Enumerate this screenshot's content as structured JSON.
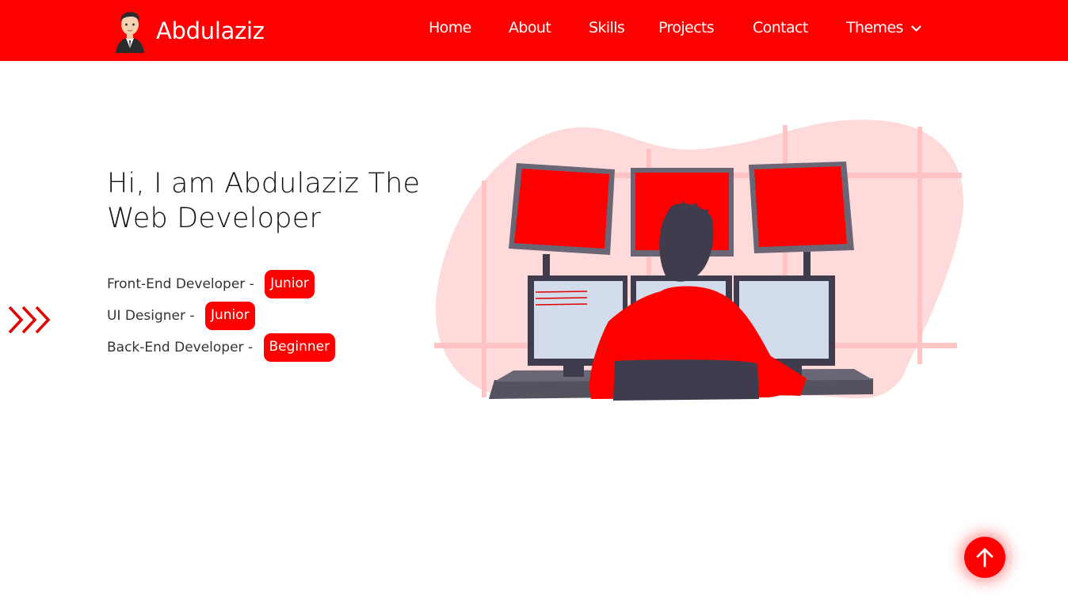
{
  "brand": {
    "name": "Abdulaziz",
    "avatar_icon": "developer-avatar-icon"
  },
  "nav": {
    "home": "Home",
    "about": "About",
    "skills": "Skills",
    "projects": "Projects",
    "contact": "Contact",
    "themes": "Themes",
    "themes_icon": "chevron-down-icon"
  },
  "hero": {
    "title": "Hi, I am Abdulaziz The Web Developer",
    "roles": [
      {
        "label": "Front-End Developer - ",
        "level": "Junior"
      },
      {
        "label": "UI Designer - ",
        "level": "Junior"
      },
      {
        "label": "Back-End Developer - ",
        "level": "Beginner"
      }
    ],
    "illustration_icon": "developer-at-monitors-illustration"
  },
  "decor": {
    "arrows_icon": "triple-chevron-right-icon"
  },
  "back_to_top": {
    "icon": "arrow-up-icon"
  },
  "next_section": {
    "heading": ""
  },
  "colors": {
    "accent": "#ff0000",
    "background": "#ffffff",
    "text": "#111111"
  }
}
